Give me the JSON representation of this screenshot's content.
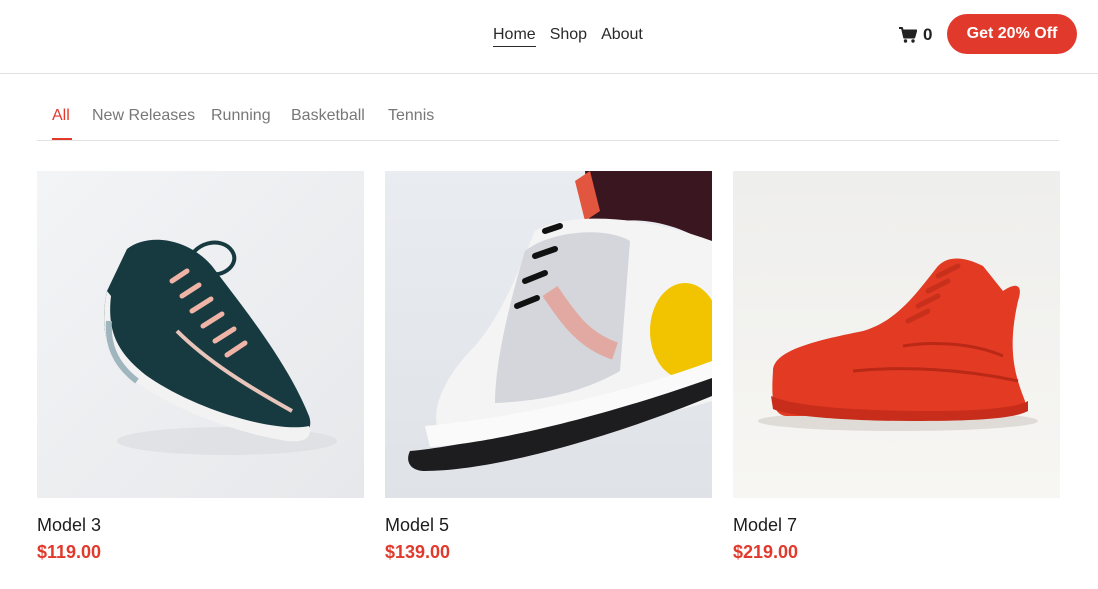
{
  "nav": {
    "items": [
      {
        "label": "Home",
        "active": true
      },
      {
        "label": "Shop",
        "active": false
      },
      {
        "label": "About",
        "active": false
      }
    ]
  },
  "cart": {
    "count": "0",
    "icon": "shopping-cart-icon"
  },
  "promo": {
    "label": "Get 20% Off"
  },
  "tabs": [
    {
      "label": "All",
      "active": true
    },
    {
      "label": "New Releases",
      "active": false
    },
    {
      "label": "Running",
      "active": false
    },
    {
      "label": "Basketball",
      "active": false
    },
    {
      "label": "Tennis",
      "active": false
    }
  ],
  "products": [
    {
      "name": "Model 3",
      "price": "$119.00"
    },
    {
      "name": "Model 5",
      "price": "$139.00"
    },
    {
      "name": "Model 7",
      "price": "$219.00"
    }
  ],
  "colors": {
    "accent": "#e13a2c",
    "text": "#222222",
    "muted": "#777777",
    "divider": "#e2e2e2"
  }
}
